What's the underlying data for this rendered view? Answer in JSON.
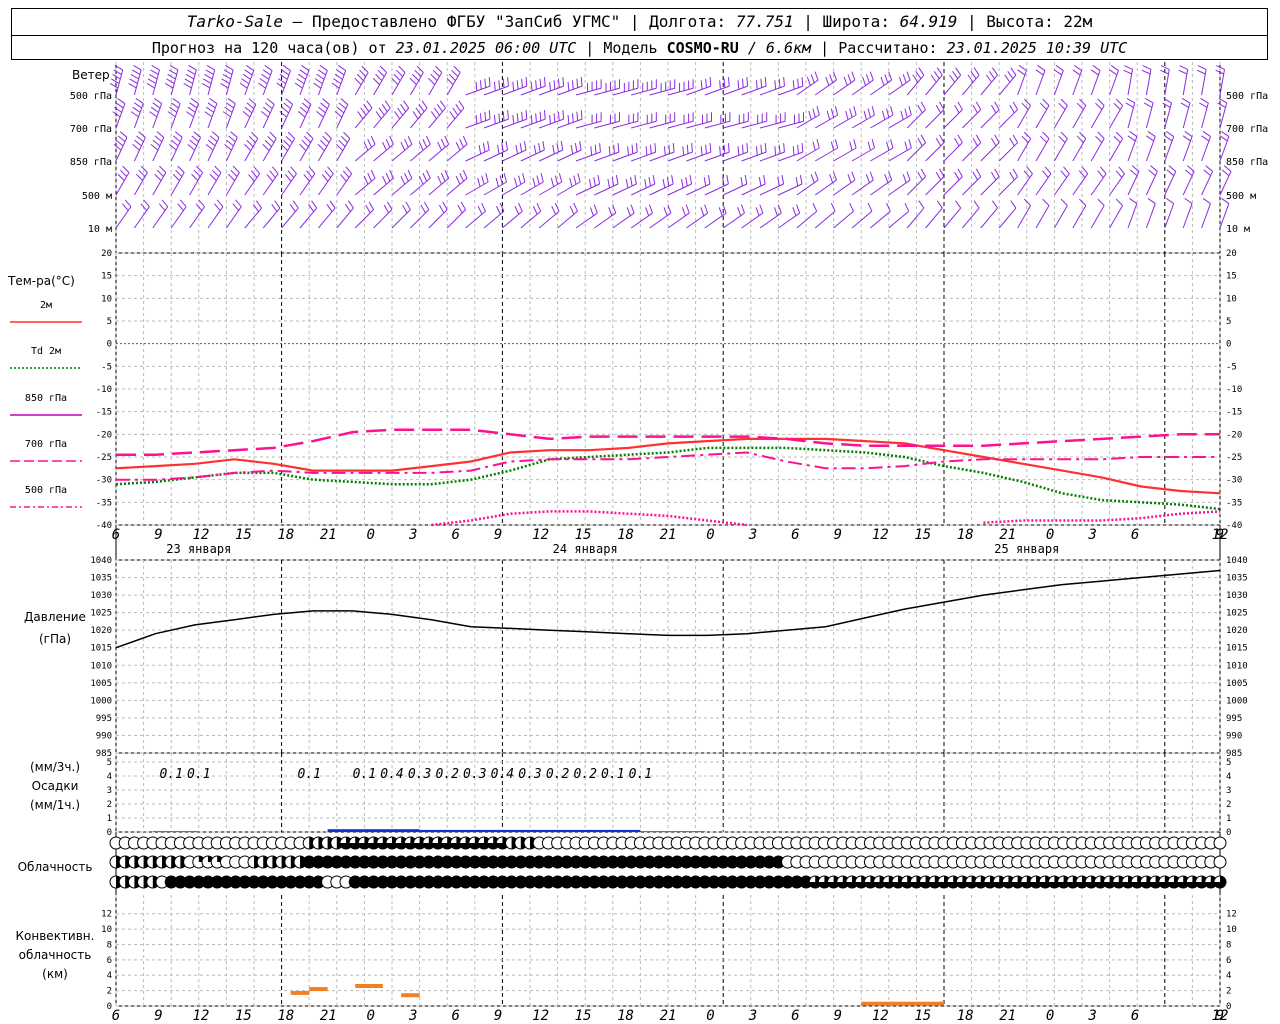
{
  "header": {
    "station": "Tarko-Sale",
    "dash": "–",
    "provider": "Предоставлено ФГБУ \"ЗапСиб УГМС\"",
    "lon_label": "Долгота:",
    "lon_value": "77.751",
    "lat_label": "Широта:",
    "lat_value": "64.919",
    "alt_label": "Высота:",
    "alt_value": "22м",
    "forecast_prefix": "Прогноз на 120 часа(ов) от",
    "forecast_start": "23.01.2025 06:00 UTC",
    "model_prefix": "Модель",
    "model_name": "COSMO-RU",
    "model_res": "/ 6.6км",
    "calc_label": "Рассчитано:",
    "calc_value": "23.01.2025 10:39 UTC"
  },
  "wind_panel": {
    "title": "Ветер",
    "levels": [
      "500 гПа",
      "700 гПа",
      "850 гПа",
      "500 м",
      "10 м"
    ]
  },
  "temp_panel": {
    "title": "Тем-ра(°C)",
    "legend": [
      {
        "label": "2м",
        "color": "#ff3030",
        "style": "solid"
      },
      {
        "label": "Td 2м",
        "color": "#008000",
        "style": "dotted"
      },
      {
        "label": "850 гПа",
        "color": "#c000c0",
        "style": "solid"
      },
      {
        "label": "700 гПа",
        "color": "#ff1090",
        "style": "dash"
      },
      {
        "label": "500 гПа",
        "color": "#ff1090",
        "style": "dashdot"
      }
    ],
    "yticks": [
      "20",
      "15",
      "10",
      "5",
      "0",
      "-5",
      "-10",
      "-15",
      "-20",
      "-25",
      "-30",
      "-35",
      "-40"
    ]
  },
  "time_axis": {
    "hours": [
      "6",
      "9",
      "12",
      "15",
      "18",
      "21",
      "0",
      "3",
      "6",
      "9",
      "12",
      "15",
      "18",
      "21",
      "0",
      "3",
      "6",
      "9",
      "12",
      "15",
      "18",
      "21",
      "0",
      "3",
      "6",
      "9",
      "12"
    ],
    "days": [
      "23 января",
      "24 января",
      "25 января"
    ]
  },
  "pressure_panel": {
    "title": "Давление",
    "unit": "(гПа)",
    "yticks": [
      "1040",
      "1035",
      "1030",
      "1025",
      "1020",
      "1015",
      "1010",
      "1005",
      "1000",
      "995",
      "990",
      "985"
    ]
  },
  "precip_panel": {
    "unit3": "(мм/3ч.)",
    "title": "Осадки",
    "unit1": "(мм/1ч.)",
    "yticks": [
      "5",
      "4",
      "3",
      "2",
      "1",
      "0"
    ],
    "labels": [
      "0.1",
      "0.1",
      "0.1",
      "0.1",
      "0.4",
      "0.3",
      "0.2",
      "0.3",
      "0.4",
      "0.3",
      "0.2",
      "0.2",
      "0.1",
      "0.1"
    ]
  },
  "cloud_panel": {
    "title": "Облачность"
  },
  "conv_panel": {
    "title1": "Конвективн.",
    "title2": "облачность",
    "unit": "(км)",
    "yticks": [
      "12",
      "10",
      "8",
      "6",
      "4",
      "2",
      "0"
    ]
  },
  "colors": {
    "wind": "#8a2be2",
    "t2m": "#ff3030",
    "td2m": "#008000",
    "t700": "#ff1090",
    "t500": "#ff1090",
    "pressure": "#000000",
    "precip": "#1030d0",
    "conv": "#f08020",
    "zero_line": "#3050ff"
  },
  "chart_data": [
    {
      "type": "line",
      "title": "Тем-ра(°C)",
      "x_hours_from_start": [
        0,
        3,
        6,
        9,
        12,
        15,
        18,
        21,
        24,
        27,
        30,
        33,
        36,
        39,
        42,
        45,
        48,
        51,
        54,
        57,
        60,
        63,
        66,
        69,
        72,
        75,
        78,
        81,
        84,
        87,
        90,
        93,
        96,
        99,
        102,
        105,
        108,
        111,
        114,
        117,
        120
      ],
      "ylim": [
        -40,
        20
      ],
      "series": [
        {
          "name": "2м",
          "values": [
            -27.5,
            -27,
            -26.5,
            -25.5,
            -26.5,
            -28,
            -28,
            -28,
            -27,
            -26,
            -24,
            -23.5,
            -23.5,
            -23,
            -22,
            -21.5,
            -21,
            -21,
            -21,
            -21.5,
            -22,
            -23.5,
            -25,
            -26.5,
            -28,
            -29.5,
            -31.5,
            -32.5,
            -33
          ]
        },
        {
          "name": "Td 2м",
          "values": [
            -31,
            -30.5,
            -29.5,
            -28.5,
            -28.5,
            -30,
            -30.5,
            -31,
            -31,
            -30,
            -28,
            -25.5,
            -25,
            -24.5,
            -24,
            -23,
            -23,
            -23,
            -23.5,
            -24,
            -25,
            -27,
            -28.5,
            -30.5,
            -33,
            -34.5,
            -35,
            -35.5,
            -36.5
          ]
        },
        {
          "name": "700 гПа",
          "values": [
            -24.5,
            -24.5,
            -24,
            -23.5,
            -23,
            -21.5,
            -19.5,
            -19,
            -19,
            -19,
            -20,
            -21,
            -20.5,
            -20.5,
            -20.5,
            -20.5,
            -20.5,
            -21,
            -22,
            -22.5,
            -22.5,
            -22.5,
            -22.5,
            -22,
            -21.5,
            -21,
            -20.5,
            -20,
            -20
          ]
        },
        {
          "name": "500 гПа",
          "values": [
            -30,
            -30,
            -29.5,
            -28.5,
            -28,
            -28.5,
            -28.5,
            -28.5,
            -28.5,
            -28,
            -26,
            -25.5,
            -25.5,
            -25.5,
            -25,
            -24.5,
            -24,
            -26,
            -27.5,
            -27.5,
            -27,
            -26,
            -25.5,
            -25.5,
            -25.5,
            -25.5,
            -25,
            -25,
            -25
          ]
        },
        {
          "name": "850 гПа",
          "values": [
            null,
            null,
            null,
            null,
            null,
            null,
            null,
            null,
            -40,
            -39,
            -37.5,
            -37,
            -37,
            -37.5,
            -38,
            -39,
            -40,
            null,
            null,
            null,
            null,
            null,
            -39.5,
            -39,
            -39,
            -39,
            -38.5,
            -37.5,
            -37
          ]
        }
      ]
    },
    {
      "type": "line",
      "title": "Давление",
      "ylim": [
        985,
        1040
      ],
      "series": [
        {
          "name": "Давление",
          "values": [
            1015,
            1019,
            1021.5,
            1023,
            1024.5,
            1025.5,
            1025.5,
            1024.5,
            1023,
            1021,
            1020.5,
            1020,
            1019.5,
            1019,
            1018.5,
            1018.5,
            1019,
            1020,
            1021,
            1023.5,
            1026,
            1028,
            1030,
            1031.5,
            1033,
            1034,
            1035,
            1036,
            1037
          ]
        }
      ]
    },
    {
      "type": "bar",
      "title": "Осадки",
      "ylim": [
        0,
        5
      ],
      "labels_3h": [
        "0.1",
        "0.1",
        "0.1",
        "0.1",
        "0.4",
        "0.3",
        "0.2",
        "0.3",
        "0.4",
        "0.3",
        "0.2",
        "0.2",
        "0.1",
        "0.1"
      ]
    },
    {
      "type": "bar",
      "title": "Конвективн. облачность",
      "ylim": [
        0,
        13
      ],
      "values_km": [
        1.7,
        2.2,
        2.6,
        1.4,
        0.3
      ]
    }
  ]
}
